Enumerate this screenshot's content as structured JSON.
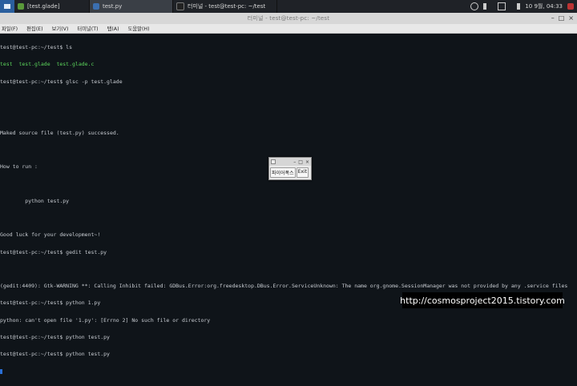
{
  "taskbar": {
    "tasks": [
      {
        "label": "[test.glade]",
        "icon_color": "#5a9a3a"
      },
      {
        "label": "test.py",
        "icon_color": "#3b6fb0",
        "active": true
      },
      {
        "label": "터미널 - test@test-pc: ~/test",
        "icon_color": "#222222"
      }
    ],
    "clock": "10 9월, 04:33"
  },
  "terminal": {
    "title": "터미널 - test@test-pc: ~/test",
    "menu": [
      "파일(F)",
      "편집(E)",
      "보기(V)",
      "터미널(T)",
      "탭(A)",
      "도움말(H)"
    ],
    "lines": [
      "test@test-pc:~/test$ ls",
      "test  test.glade  test.glade.c",
      "test@test-pc:~/test$ glsc -p test.glade",
      "",
      "",
      "Maked source file (test.py) successed.",
      "",
      "How to run :",
      "",
      "        python test.py",
      "",
      "Good luck for your development~!",
      "test@test-pc:~/test$ gedit test.py",
      "",
      "(gedit:4409): Gtk-WARNING **: Calling Inhibit failed: GDBus.Error:org.freedesktop.DBus.Error.ServiceUnknown: The name org.gnome.SessionManager was not provided by any .service files",
      "test@test-pc:~/test$ python 1.py",
      "python: can't open file '1.py': [Errno 2] No such file or directory",
      "test@test-pc:~/test$ python test.py",
      "test@test-pc:~/test$ python test.py"
    ]
  },
  "mini_window": {
    "buttons": [
      "파이어폭스",
      "Exit"
    ]
  },
  "watermark": "http://cosmosproject2015.tistory.com"
}
